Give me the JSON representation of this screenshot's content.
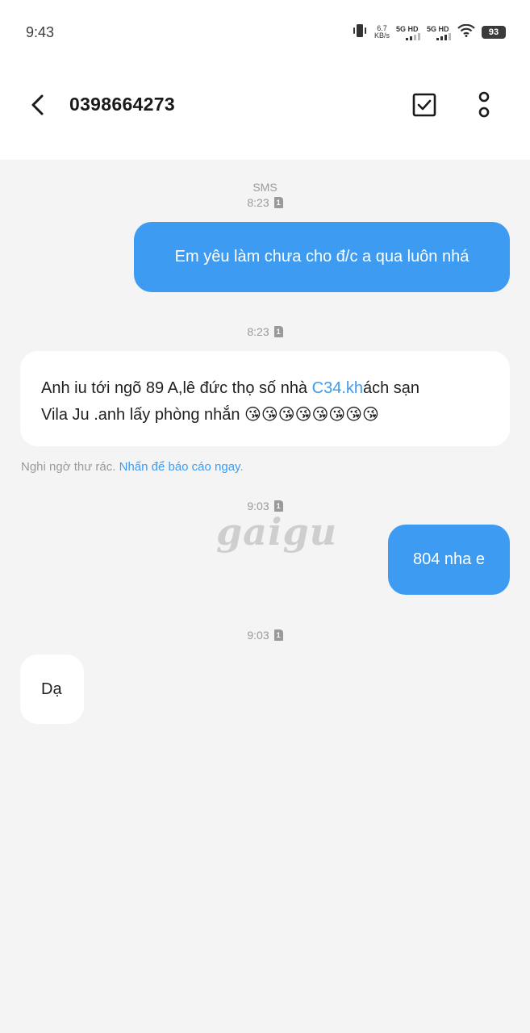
{
  "status_bar": {
    "time": "9:43",
    "net_speed_value": "6.7",
    "net_speed_unit": "KB/s",
    "sim1_label": "5G HD",
    "sim2_label": "5G HD",
    "battery": "93"
  },
  "header": {
    "title": "0398664273",
    "back_icon": "chevron-left-icon",
    "select_icon": "checkbox-icon",
    "more_icon": "more-vertical-icon"
  },
  "conversation": {
    "channel_label": "SMS",
    "sim_badge": "1",
    "messages": [
      {
        "direction": "outgoing",
        "time": "8:23",
        "text": "Em yêu làm chưa cho đ/c a qua luôn nhá"
      },
      {
        "direction": "incoming",
        "time": "8:23",
        "text_line1_before_link": "Anh iu tới ngõ 89 A,lê đức thọ số nhà ",
        "link_text": "C34.kh",
        "text_line1_after_link": "ách sạn",
        "text_line2": "Vila Ju .anh lấy phòng nhắn 😘😘😘😘😘😘😘😘"
      },
      {
        "direction": "outgoing",
        "time": "9:03",
        "text": "804 nha e"
      },
      {
        "direction": "incoming",
        "time": "9:03",
        "text": "Dạ"
      }
    ],
    "spam_notice": "Nghi ngờ thư rác. ",
    "spam_action": "Nhấn để báo cáo ngay",
    "spam_end": "."
  },
  "watermark": "gaigu",
  "colors": {
    "accent": "#3d9bf2",
    "background": "#f4f4f5",
    "bubble_incoming": "#ffffff"
  }
}
